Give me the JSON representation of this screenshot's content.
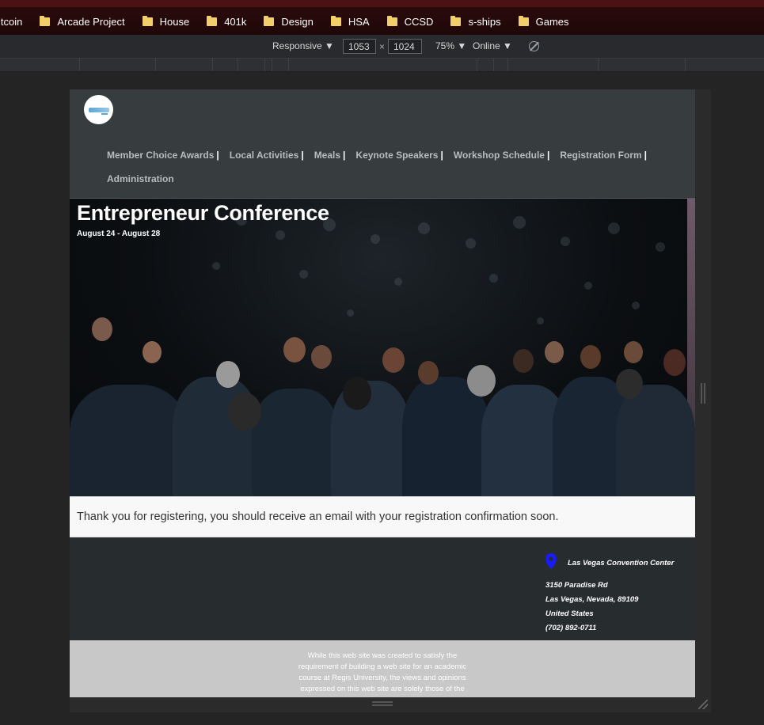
{
  "bookmarks": [
    {
      "label": "itcoin",
      "folder": false
    },
    {
      "label": "Arcade Project",
      "folder": true
    },
    {
      "label": "House",
      "folder": true
    },
    {
      "label": "401k",
      "folder": true
    },
    {
      "label": "Design",
      "folder": true
    },
    {
      "label": "HSA",
      "folder": true
    },
    {
      "label": "CCSD",
      "folder": true
    },
    {
      "label": "s-ships",
      "folder": true
    },
    {
      "label": "Games",
      "folder": true
    }
  ],
  "devtools": {
    "device_mode": "Responsive ▼",
    "width_value": "1053",
    "times": "×",
    "height_value": "1024",
    "zoom": "75% ▼",
    "network": "Online ▼"
  },
  "site": {
    "nav": [
      "Member Choice Awards",
      "Local Activities",
      "Meals",
      "Keynote Speakers",
      "Workshop Schedule",
      "Registration Form",
      "Administration"
    ],
    "nav_separator": "|",
    "hero": {
      "title": "Entrepreneur Conference",
      "dates": "August 24 - August 28"
    },
    "confirmation": "Thank you for registering, you should receive an email with your registration confirmation soon.",
    "venue": {
      "name": "Las Vegas Convention Center",
      "street": "3150 Paradise Rd",
      "city": "Las Vegas, Nevada, 89109",
      "country": "United States",
      "phone": "(702) 892-0711",
      "pin_color": "#1a1aff"
    },
    "disclaimer": "While this web site was created to satisfy the requirement of building a web site for an academic course at Regis University, the views and opinions expressed on this web site are solely those of the"
  }
}
